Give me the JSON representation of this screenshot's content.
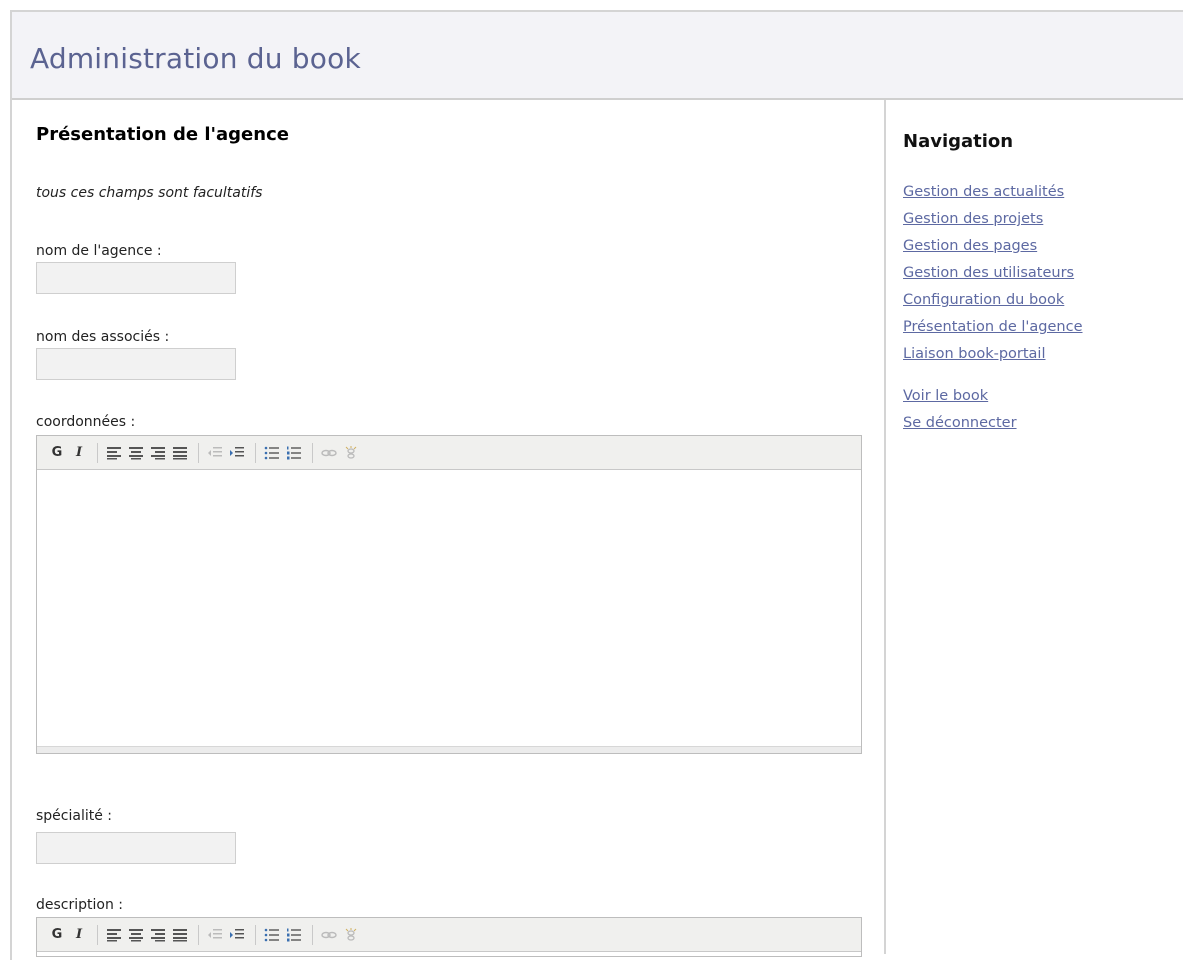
{
  "header": {
    "title": "Administration du book"
  },
  "form": {
    "heading": "Présentation de l'agence",
    "note": "tous ces champs sont facultatifs",
    "fields": {
      "agency_name": {
        "label": "nom de l'agence :",
        "value": ""
      },
      "partners": {
        "label": "nom des associés :",
        "value": ""
      },
      "coordinates": {
        "label": "coordonnées :",
        "value": ""
      },
      "specialty": {
        "label": "spécialité :",
        "value": ""
      },
      "description": {
        "label": "description :",
        "value": ""
      }
    },
    "toolbar": {
      "bold": "G",
      "italic": "I",
      "icons": [
        "align-left-icon",
        "align-center-icon",
        "align-right-icon",
        "align-justify-icon",
        "outdent-icon",
        "indent-icon",
        "bullet-list-icon",
        "numbered-list-icon",
        "link-icon",
        "unlink-icon"
      ]
    }
  },
  "sidebar": {
    "title": "Navigation",
    "links": [
      "Gestion des actualités",
      "Gestion des projets",
      "Gestion des pages",
      "Gestion des utilisateurs",
      "Configuration du book",
      "Présentation de l'agence",
      "Liaison book-portail"
    ],
    "links2": [
      "Voir le book",
      "Se déconnecter"
    ]
  },
  "colors": {
    "title": "#5b6391",
    "link": "#5d69a2",
    "header_bg": "#f3f3f7"
  }
}
